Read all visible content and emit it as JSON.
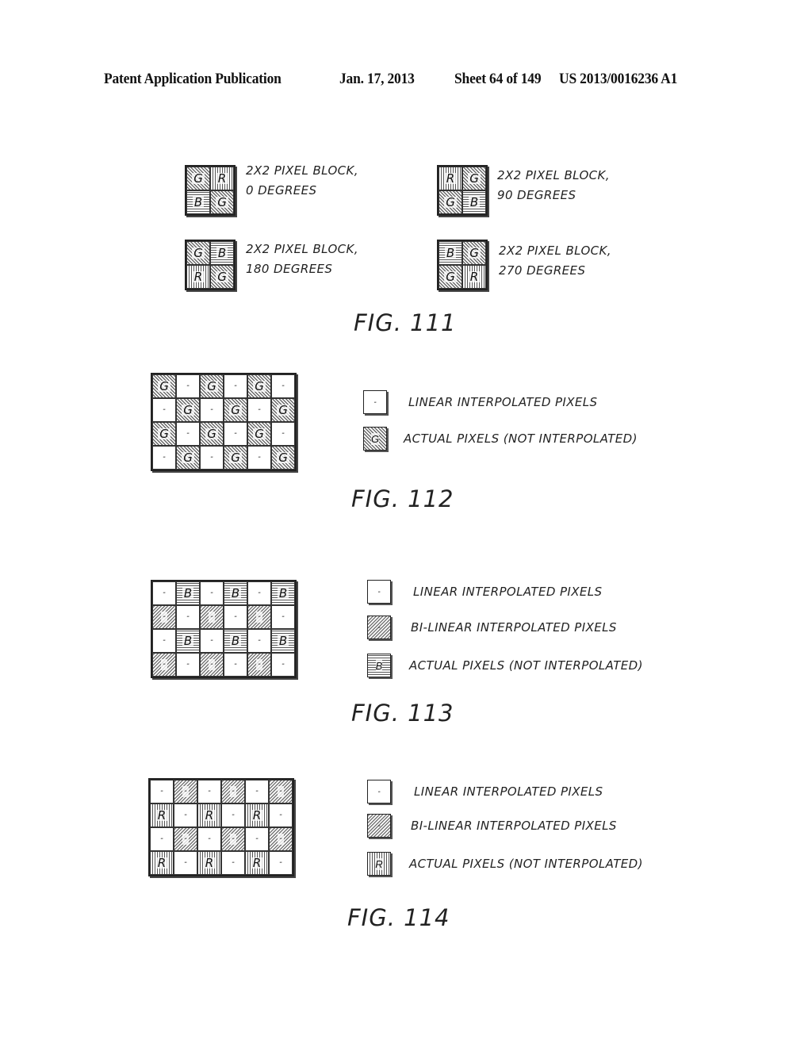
{
  "header": {
    "publication": "Patent Application Publication",
    "date": "Jan. 17, 2013",
    "sheet": "Sheet 64 of 149",
    "patent_number": "US 2013/0016236 A1"
  },
  "fig111": {
    "label": "FIG. 111",
    "blocks": [
      {
        "cells": [
          [
            "G",
            "R"
          ],
          [
            "B",
            "G"
          ]
        ],
        "line1": "2X2 PIXEL BLOCK,",
        "line2": "0 DEGREES"
      },
      {
        "cells": [
          [
            "R",
            "G"
          ],
          [
            "G",
            "B"
          ]
        ],
        "line1": "2X2 PIXEL BLOCK,",
        "line2": "90 DEGREES"
      },
      {
        "cells": [
          [
            "G",
            "B"
          ],
          [
            "R",
            "G"
          ]
        ],
        "line1": "2X2 PIXEL BLOCK,",
        "line2": "180 DEGREES"
      },
      {
        "cells": [
          [
            "B",
            "G"
          ],
          [
            "G",
            "R"
          ]
        ],
        "line1": "2X2 PIXEL BLOCK,",
        "line2": "270 DEGREES"
      }
    ]
  },
  "fig112": {
    "label": "FIG. 112",
    "grid": [
      [
        "G",
        "-",
        "G",
        "-",
        "G",
        "-"
      ],
      [
        "-",
        "G",
        "-",
        "G",
        "-",
        "G"
      ],
      [
        "G",
        "-",
        "G",
        "-",
        "G",
        "-"
      ],
      [
        "-",
        "G",
        "-",
        "G",
        "-",
        "G"
      ]
    ],
    "legend": [
      {
        "symbol": "-",
        "type": "lin",
        "text": "LINEAR INTERPOLATED PIXELS"
      },
      {
        "symbol": "G",
        "type": "G",
        "text": "ACTUAL PIXELS (NOT INTERPOLATED)"
      }
    ]
  },
  "fig113": {
    "label": "FIG. 113",
    "grid": [
      [
        "-",
        "B",
        "-",
        "B",
        "-",
        "B"
      ],
      [
        "bi",
        "-",
        "bi",
        "-",
        "bi",
        "-"
      ],
      [
        "-",
        "B",
        "-",
        "B",
        "-",
        "B"
      ],
      [
        "bi",
        "-",
        "bi",
        "-",
        "bi",
        "-"
      ]
    ],
    "legend": [
      {
        "symbol": "-",
        "type": "lin",
        "text": "LINEAR INTERPOLATED PIXELS"
      },
      {
        "symbol": "-",
        "type": "bi",
        "text": "BI-LINEAR INTERPOLATED PIXELS"
      },
      {
        "symbol": "B",
        "type": "B",
        "text": "ACTUAL PIXELS (NOT INTERPOLATED)"
      }
    ]
  },
  "fig114": {
    "label": "FIG. 114",
    "grid": [
      [
        "-",
        "bi",
        "-",
        "bi",
        "-",
        "bi"
      ],
      [
        "R",
        "-",
        "R",
        "-",
        "R",
        "-"
      ],
      [
        "-",
        "bi",
        "-",
        "bi",
        "-",
        "bi"
      ],
      [
        "R",
        "-",
        "R",
        "-",
        "R",
        "-"
      ]
    ],
    "legend": [
      {
        "symbol": "-",
        "type": "lin",
        "text": "LINEAR INTERPOLATED PIXELS"
      },
      {
        "symbol": "-",
        "type": "bi",
        "text": "BI-LINEAR INTERPOLATED PIXELS"
      },
      {
        "symbol": "R",
        "type": "R",
        "text": "ACTUAL PIXELS (NOT INTERPOLATED)"
      }
    ]
  }
}
